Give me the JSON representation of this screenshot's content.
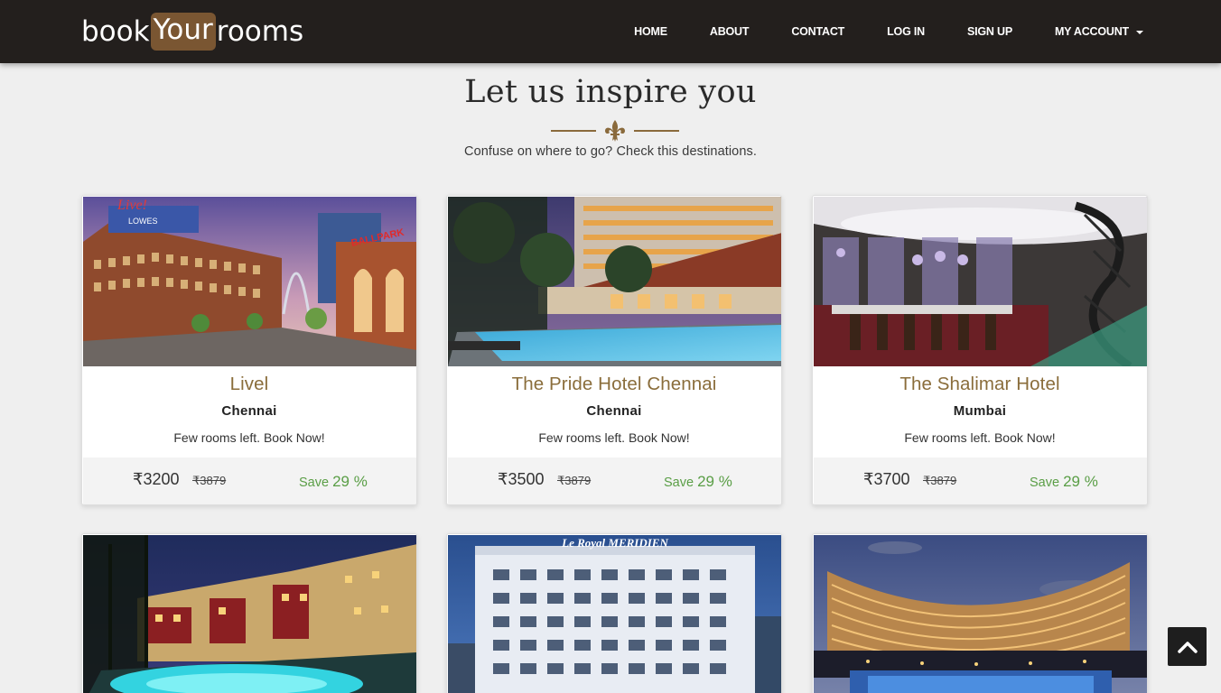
{
  "brand": {
    "part1": "book",
    "part2": "Your",
    "part3": "rooms"
  },
  "nav": {
    "items": [
      "HOME",
      "ABOUT",
      "CONTACT",
      "LOG IN",
      "SIGN UP"
    ],
    "account": "MY ACCOUNT"
  },
  "section": {
    "title": "Let us inspire you",
    "subtitle": "Confuse on where to go? Check this destinations."
  },
  "hotels": [
    {
      "name": "Livel",
      "city": "Chennai",
      "note": "Few rooms left. Book Now!",
      "price": "₹3200",
      "old_price": "₹3879",
      "save_label": "Save",
      "save_pct": "29 %"
    },
    {
      "name": "The Pride Hotel Chennai",
      "city": "Chennai",
      "note": "Few rooms left. Book Now!",
      "price": "₹3500",
      "old_price": "₹3879",
      "save_label": "Save",
      "save_pct": "29 %"
    },
    {
      "name": "The Shalimar Hotel",
      "city": "Mumbai",
      "note": "Few rooms left. Book Now!",
      "price": "₹3700",
      "old_price": "₹3879",
      "save_label": "Save",
      "save_pct": "29 %"
    },
    {
      "sign": ""
    },
    {
      "sign": "Le Royal MERIDIEN"
    },
    {
      "sign": ""
    }
  ],
  "photo_sign": {
    "live": "Live!",
    "lowes": "LOWES",
    "stadium": "BALLPARK"
  },
  "colors": {
    "navbar": "#231f1d",
    "accent_brown": "#8a6d3b",
    "save_green": "#5a9e46",
    "logo_highlight": "#7a5632"
  },
  "icons": {
    "divider": "fleur-de-lis-icon",
    "to_top": "chevron-up-icon",
    "account": "caret-down-icon"
  }
}
